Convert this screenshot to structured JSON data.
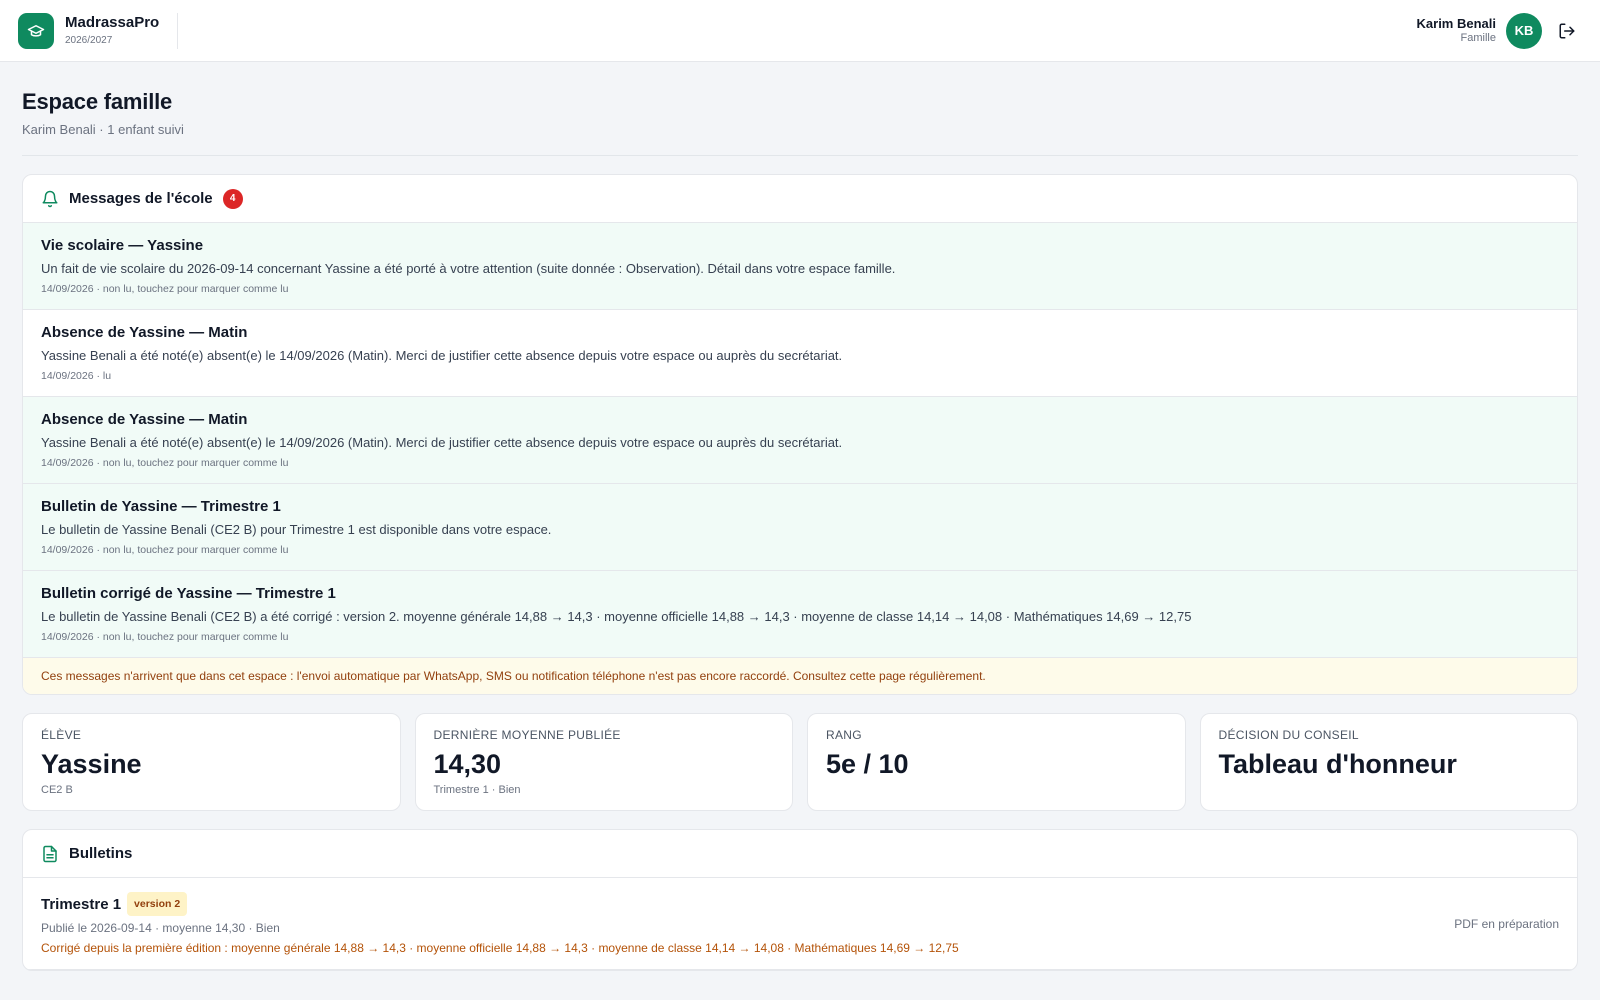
{
  "app": {
    "name": "MadrassaPro",
    "year": "2026/2027",
    "logo_icon": "graduation-cap-icon",
    "accent": "#0f8a5f"
  },
  "user": {
    "name": "Karim Benali",
    "role": "Famille",
    "initials": "KB",
    "logout_icon": "logout-icon"
  },
  "page": {
    "title": "Espace famille",
    "subtitle": "Karim Benali · 1 enfant suivi"
  },
  "messages": {
    "title": "Messages de l'école",
    "count": "4",
    "icon": "bell-icon",
    "items": [
      {
        "title": "Vie scolaire — Yassine",
        "body": "Un fait de vie scolaire du 2026-09-14 concernant Yassine a été porté à votre attention (suite donnée : Observation). Détail dans votre espace famille.",
        "meta": "14/09/2026 · non lu, touchez pour marquer comme lu",
        "unread": true
      },
      {
        "title": "Absence de Yassine — Matin",
        "body": "Yassine Benali a été noté(e) absent(e) le 14/09/2026 (Matin). Merci de justifier cette absence depuis votre espace ou auprès du secrétariat.",
        "meta": "14/09/2026 · lu",
        "unread": false
      },
      {
        "title": "Absence de Yassine — Matin",
        "body": "Yassine Benali a été noté(e) absent(e) le 14/09/2026 (Matin). Merci de justifier cette absence depuis votre espace ou auprès du secrétariat.",
        "meta": "14/09/2026 · non lu, touchez pour marquer comme lu",
        "unread": true
      },
      {
        "title": "Bulletin de Yassine — Trimestre 1",
        "body": "Le bulletin de Yassine Benali (CE2 B) pour Trimestre 1 est disponible dans votre espace.",
        "meta": "14/09/2026 · non lu, touchez pour marquer comme lu",
        "unread": true
      },
      {
        "title": "Bulletin corrigé de Yassine — Trimestre 1",
        "body": "Le bulletin de Yassine Benali (CE2 B) a été corrigé : version 2. moyenne générale 14,88 → 14,3 · moyenne officielle 14,88 → 14,3 · moyenne de classe 14,14 → 14,08 · Mathématiques 14,69 → 12,75",
        "meta": "14/09/2026 · non lu, touchez pour marquer comme lu",
        "unread": true
      }
    ],
    "notice": "Ces messages n'arrivent que dans cet espace : l'envoi automatique par WhatsApp, SMS ou notification téléphone n'est pas encore raccordé. Consultez cette page régulièrement."
  },
  "stats": [
    {
      "label": "Élève",
      "value": "Yassine",
      "sub": "CE2 B"
    },
    {
      "label": "Dernière moyenne publiée",
      "value": "14,30",
      "sub": "Trimestre 1 · Bien"
    },
    {
      "label": "Rang",
      "value": "5e / 10",
      "sub": ""
    },
    {
      "label": "Décision du conseil",
      "value": "Tableau d'honneur",
      "sub": ""
    }
  ],
  "bulletins": {
    "title": "Bulletins",
    "icon": "document-icon",
    "items": [
      {
        "title": "Trimestre 1",
        "version": "version 2",
        "meta": "Publié le 2026-09-14 · moyenne 14,30 · Bien",
        "correction": "Corrigé depuis la première édition : moyenne générale 14,88 → 14,3 · moyenne officielle 14,88 → 14,3 · moyenne de classe 14,14 → 14,08 · Mathématiques 14,69 → 12,75",
        "pdf": "PDF en préparation"
      }
    ]
  }
}
